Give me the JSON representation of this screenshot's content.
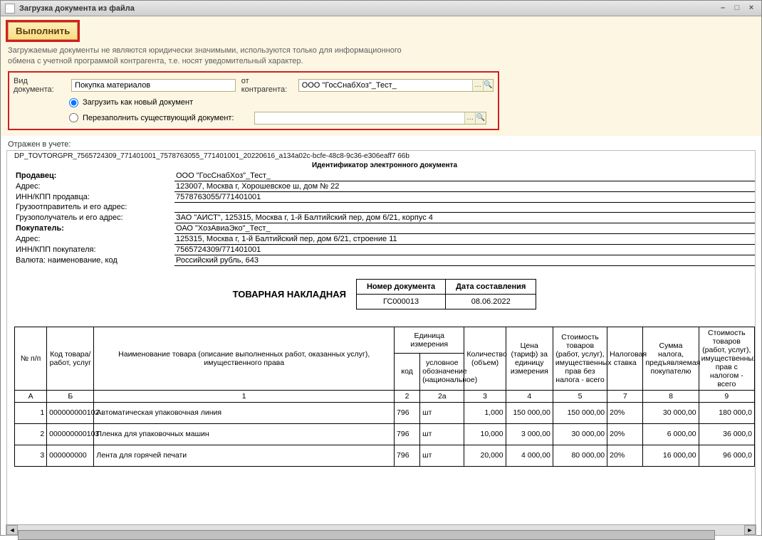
{
  "window": {
    "title": "Загрузка документа из файла"
  },
  "toolbar": {
    "execute": "Выполнить"
  },
  "infoText": "Загружаемые документы не являются юридически значимыми, используются только для информационного\nобмена с учетной программой контрагента, т.е. носят уведомительный характер.",
  "form": {
    "docTypeLabel": "Вид документа:",
    "docTypeValue": "Покупка материалов",
    "fromLabel": "от контрагента:",
    "fromValue": "ООО \"ГосСнабХоз\"_Тест_",
    "radioNew": "Загрузить как новый документ",
    "radioExisting": "Перезаполнить существующий документ:",
    "existingDocValue": ""
  },
  "reflectedLabel": "Отражен в учете:",
  "docId": "DP_TOVTORGPR_7565724309_771401001_7578763055_771401001_20220616_a134a02c-bcfe-48c8-9c36-e306eaff7 66b",
  "edocHeader": "Идентификатор электронного документа",
  "header": {
    "sellerLbl": "Продавец:",
    "sellerVal": "ООО \"ГосСнабХоз\"_Тест_",
    "addrLbl": "Адрес:",
    "addrVal": "123007, Москва г, Хорошевское ш, дом № 22",
    "innSellerLbl": "ИНН/КПП продавца:",
    "innSellerVal": "7578763055/771401001",
    "shipperLbl": "Грузоотправитель и его адрес:",
    "shipperVal": "",
    "consigneeLbl": "Грузополучатель и его адрес:",
    "consigneeVal": "ЗАО \"АИСТ\", 125315, Москва г, 1-й Балтийский пер, дом 6/21, корпус 4",
    "buyerLbl": "Покупатель:",
    "buyerVal": "ОАО \"ХозАвиаЭко\"_Тест_",
    "buyerAddrLbl": "Адрес:",
    "buyerAddrVal": "125315, Москва г, 1-й Балтийский пер, дом 6/21, строение 11",
    "innBuyerLbl": "ИНН/КПП покупателя:",
    "innBuyerVal": "7565724309/771401001",
    "currencyLbl": "Валюта: наименование, код",
    "currencyVal": "Российский рубль, 643"
  },
  "waybill": {
    "title": "ТОВАРНАЯ НАКЛАДНАЯ",
    "numHdr": "Номер документа",
    "dateHdr": "Дата составления",
    "number": "ГС000013",
    "date": "08.06.2022"
  },
  "table": {
    "headers": {
      "num": "№ п/п",
      "code": "Код товара/ работ, услуг",
      "name": "Наименование товара (описание выполненных работ, оказанных услуг), имущественного права",
      "unitGroup": "Единица измерения",
      "unitCode": "код",
      "unitCond": "условное обозначение (национальное)",
      "qty": "Количество (объем)",
      "price": "Цена (тариф) за единицу измерения",
      "costNoTax": "Стоимость товаров (работ, услуг), имущественных прав без налога - всего",
      "taxRate": "Налоговая ставка",
      "taxSum": "Сумма налога, предъявляемая покупателю",
      "costWithTax": "Стоимость товаров (работ, услуг), имущественных прав с налогом - всего"
    },
    "colIdx": {
      "a": "А",
      "b": "Б",
      "c1": "1",
      "c2": "2",
      "c2a": "2а",
      "c3": "3",
      "c4": "4",
      "c5": "5",
      "c7": "7",
      "c8": "8",
      "c9": "9"
    },
    "rows": [
      {
        "n": "1",
        "code": "000000000102",
        "name": "Автоматическая упаковочная линия",
        "ucode": "796",
        "ucond": "шт",
        "qty": "1,000",
        "price": "150 000,00",
        "costNoTax": "150 000,00",
        "rate": "20%",
        "taxSum": "30 000,00",
        "costTax": "180 000,0"
      },
      {
        "n": "2",
        "code": "000000000103",
        "name": "Пленка для упаковочных машин",
        "ucode": "796",
        "ucond": "шт",
        "qty": "10,000",
        "price": "3 000,00",
        "costNoTax": "30 000,00",
        "rate": "20%",
        "taxSum": "6 000,00",
        "costTax": "36 000,0"
      },
      {
        "n": "3",
        "code": "000000000",
        "name": "Лента для горячей печати",
        "ucode": "796",
        "ucond": "шт",
        "qty": "20,000",
        "price": "4 000,00",
        "costNoTax": "80 000,00",
        "rate": "20%",
        "taxSum": "16 000,00",
        "costTax": "96 000,0"
      }
    ]
  }
}
